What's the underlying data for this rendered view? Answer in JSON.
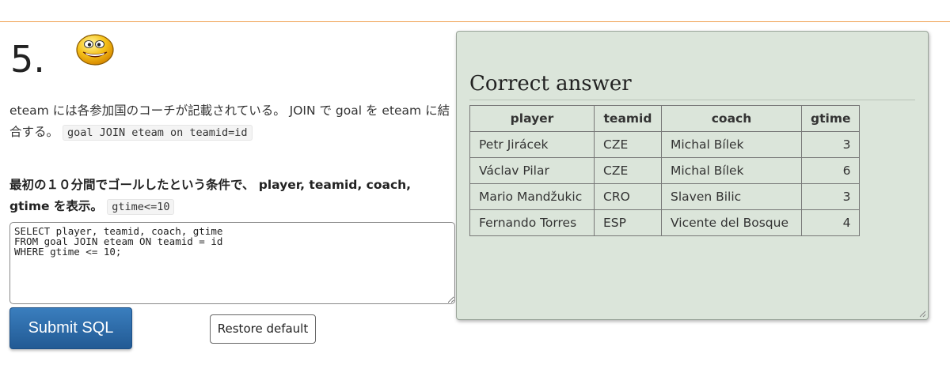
{
  "question": {
    "number": "5.",
    "description_part1": "eteam には各参加国のコーチが記載されている。 JOIN で goal を eteam に結合する。",
    "description_code": "goal JOIN eteam on teamid=id",
    "task_text": "最初の１０分間でゴールしたという条件で、 player, teamid, coach, gtime を表示。",
    "task_code": "gtime<=10"
  },
  "editor": {
    "sql": "SELECT player, teamid, coach, gtime\nFROM goal JOIN eteam ON teamid = id\nWHERE gtime <= 10;"
  },
  "buttons": {
    "submit_label": "Submit SQL",
    "restore_label": "Restore default"
  },
  "answer": {
    "title": "Correct answer",
    "columns": [
      "player",
      "teamid",
      "coach",
      "gtime"
    ],
    "rows": [
      [
        "Petr Jirácek",
        "CZE",
        "Michal Bílek",
        "3"
      ],
      [
        "Václav Pilar",
        "CZE",
        "Michal Bílek",
        "6"
      ],
      [
        "Mario Mandžukic",
        "CRO",
        "Slaven Bilic",
        "3"
      ],
      [
        "Fernando Torres",
        "ESP",
        "Vicente del Bosque",
        "4"
      ]
    ]
  },
  "icons": {
    "smiley": "smiley-face-icon",
    "resize": "resize-grip-icon"
  },
  "colors": {
    "accent_rule": "#f0a050",
    "submit_button": "#2b6aa8",
    "answer_background": "#dbe5da"
  }
}
